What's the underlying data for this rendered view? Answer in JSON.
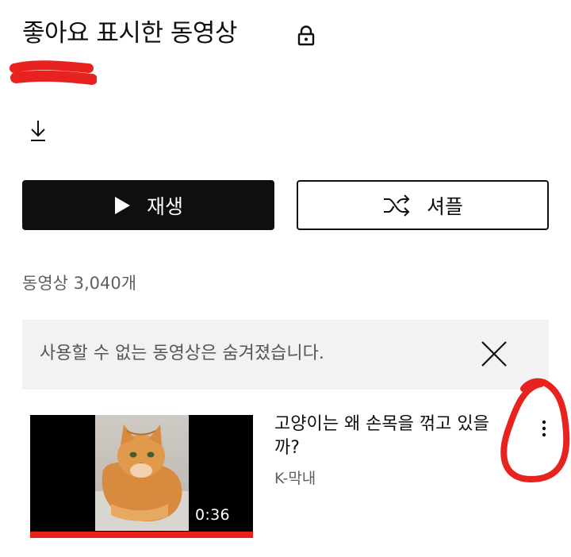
{
  "header": {
    "title": "좋아요 표시한 동영상",
    "lock_icon": "lock-icon",
    "download_icon": "download-icon"
  },
  "actions": {
    "play_label": "재생",
    "shuffle_label": "셔플",
    "play_icon": "play-icon",
    "shuffle_icon": "shuffle-icon"
  },
  "video_count": "동영상 3,040개",
  "notice": {
    "text": "사용할 수 없는 동영상은 숨겨졌습니다.",
    "close_icon": "close-icon"
  },
  "videos": [
    {
      "title": "고양이는 왜 손목을 꺾고 있을까?",
      "channel": "K-막내",
      "duration": "0:36",
      "watched_fraction": 1.0,
      "menu_icon": "more-vertical-icon"
    }
  ],
  "colors": {
    "progress": "#e62117",
    "annotation": "#e8231f",
    "notice_bg": "#f2f2f2"
  }
}
